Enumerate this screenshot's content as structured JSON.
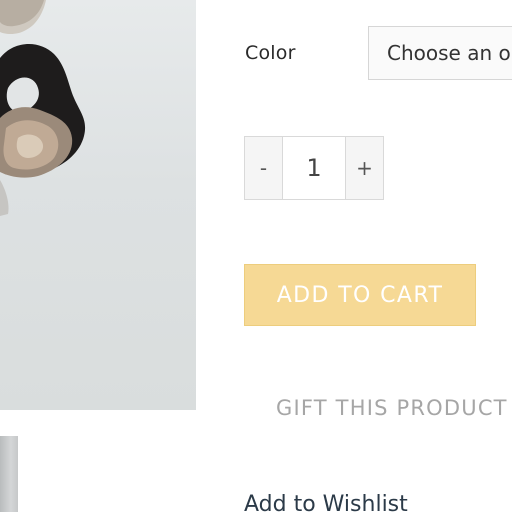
{
  "product": {
    "color_label": "Color",
    "color_select_value": "Choose an option",
    "quantity": {
      "decrement": "-",
      "value": "1",
      "increment": "+"
    },
    "add_to_cart_label": "ADD TO CART",
    "gift_label": "GIFT THIS PRODUCT",
    "wishlist_label": "Add to Wishlist"
  },
  "colors": {
    "add_to_cart_bg": "#f6d995",
    "wishlist_text": "#2b3a48",
    "gift_text": "#a6a6a6"
  }
}
